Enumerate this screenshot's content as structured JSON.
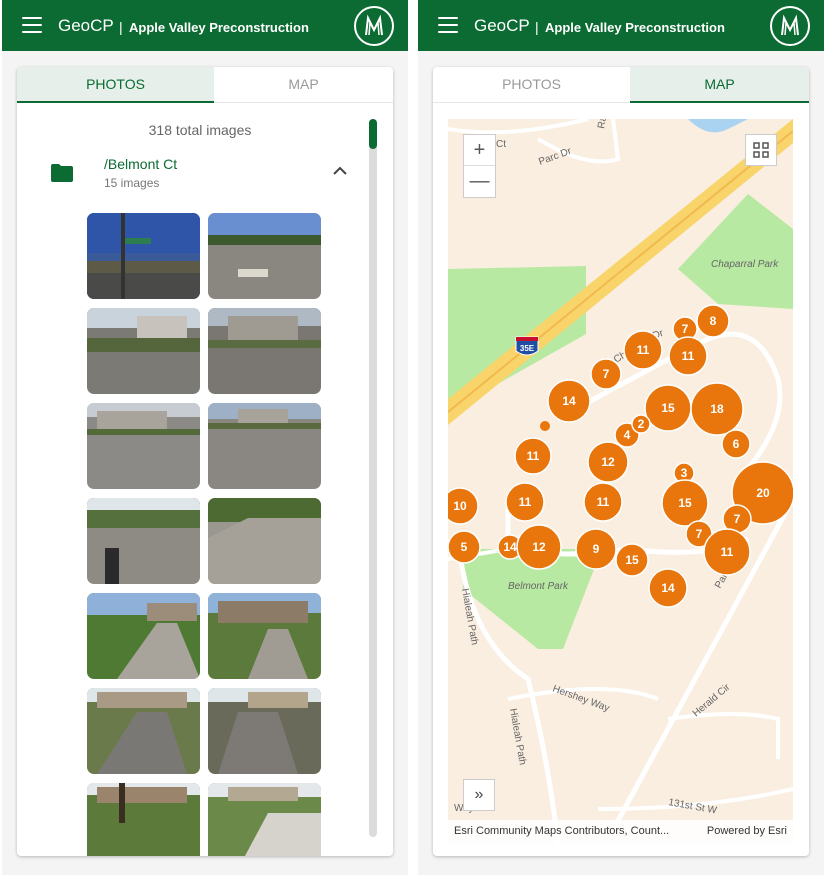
{
  "app": {
    "name": "GeoCP",
    "separator": "|",
    "project": "Apple Valley Preconstruction"
  },
  "tabs": {
    "photos": "PHOTOS",
    "map": "MAP"
  },
  "gallery": {
    "total_label": "318 total images",
    "folder": {
      "name": "/Belmont Ct",
      "count_label": "15 images"
    }
  },
  "map": {
    "zoom_in": "+",
    "zoom_out": "—",
    "expand": "»",
    "attribution": "Esri Community Maps Contributors, Count...",
    "powered_by": "Powered by Esri",
    "shield_label": "35E",
    "street_labels": [
      "Ct",
      "Parc Dr",
      "Rain",
      "Chaparral Park",
      "Belmont Park",
      "Hialeah Path",
      "Hialeah Path",
      "Hershey Way",
      "Palomino Dr",
      "Herald Cir",
      "131st St W",
      "Way",
      "Dr",
      "Ch",
      "wa"
    ],
    "clusters": [
      "7",
      "8",
      "11",
      "11",
      "7",
      "14",
      "15",
      "18",
      "4",
      "2",
      "6",
      "11",
      "12",
      "3",
      "20",
      "10",
      "11",
      "11",
      "15",
      "7",
      "7",
      "5",
      "14",
      "12",
      "9",
      "15",
      "11",
      "14"
    ],
    "colors": {
      "cluster": "#e8760c",
      "park": "#b8e9a3",
      "land": "#faeee0",
      "highway": "#f8d46a"
    }
  },
  "icons": [
    "menu-icon",
    "logo-icon",
    "folder-icon",
    "chevron-up-icon",
    "fullscreen-icon",
    "expand-icon"
  ]
}
